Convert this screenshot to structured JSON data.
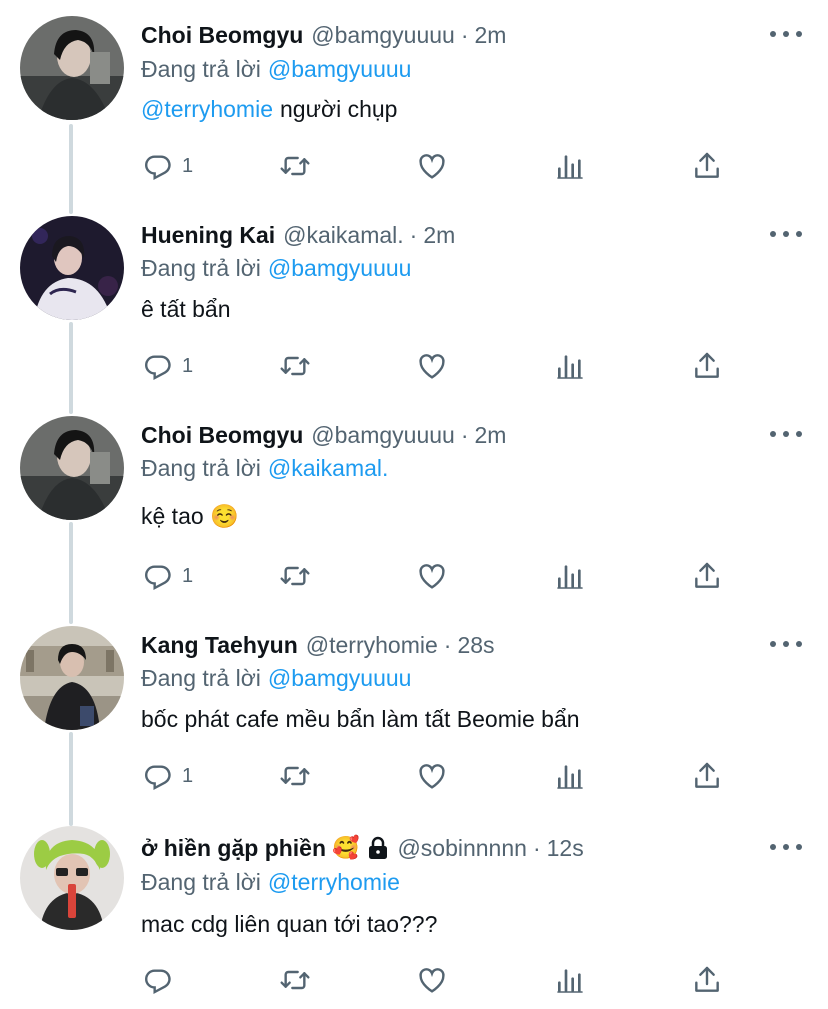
{
  "colors": {
    "text": "#0f1419",
    "secondary": "#536471",
    "link": "#1d9bf0",
    "thread": "#cfd9de"
  },
  "tweets": [
    {
      "name": "Choi Beomgyu",
      "handle": "@bamgyuuuu",
      "dot": "·",
      "time": "2m",
      "reply_prefix": "Đang trả lời",
      "reply_to": "@bamgyuuuu",
      "text_mention": "@terryhomie",
      "text": "người chụp",
      "reply_count": "1",
      "avatar_icon": "avatar-beomgyu"
    },
    {
      "name": "Huening Kai",
      "handle": "@kaikamal.",
      "dot": "·",
      "time": "2m",
      "reply_prefix": "Đang trả lời",
      "reply_to": "@bamgyuuuu",
      "text_mention": "",
      "text": "ê tất bẩn",
      "reply_count": "1",
      "avatar_icon": "avatar-kai"
    },
    {
      "name": "Choi Beomgyu",
      "handle": "@bamgyuuuu",
      "dot": "·",
      "time": "2m",
      "reply_prefix": "Đang trả lời",
      "reply_to": "@kaikamal.",
      "text_mention": "",
      "text": "kệ tao ☺️",
      "reply_count": "1",
      "avatar_icon": "avatar-beomgyu"
    },
    {
      "name": "Kang Taehyun",
      "handle": "@terryhomie",
      "dot": "·",
      "time": "28s",
      "reply_prefix": "Đang trả lời",
      "reply_to": "@bamgyuuuu",
      "text_mention": "",
      "text": "bốc phát cafe mều bẩn làm tất Beomie bẩn",
      "reply_count": "1",
      "avatar_icon": "avatar-taehyun"
    },
    {
      "name": "ở hiền gặp phiền",
      "name_emoji": "🥰",
      "handle": "@sobinnnnn",
      "dot": "·",
      "time": "12s",
      "reply_prefix": "Đang trả lời",
      "reply_to": "@terryhomie",
      "text_mention": "",
      "text": "mac cdg liên quan tới tao???",
      "reply_count": "",
      "avatar_icon": "avatar-sobin",
      "locked": true
    }
  ]
}
